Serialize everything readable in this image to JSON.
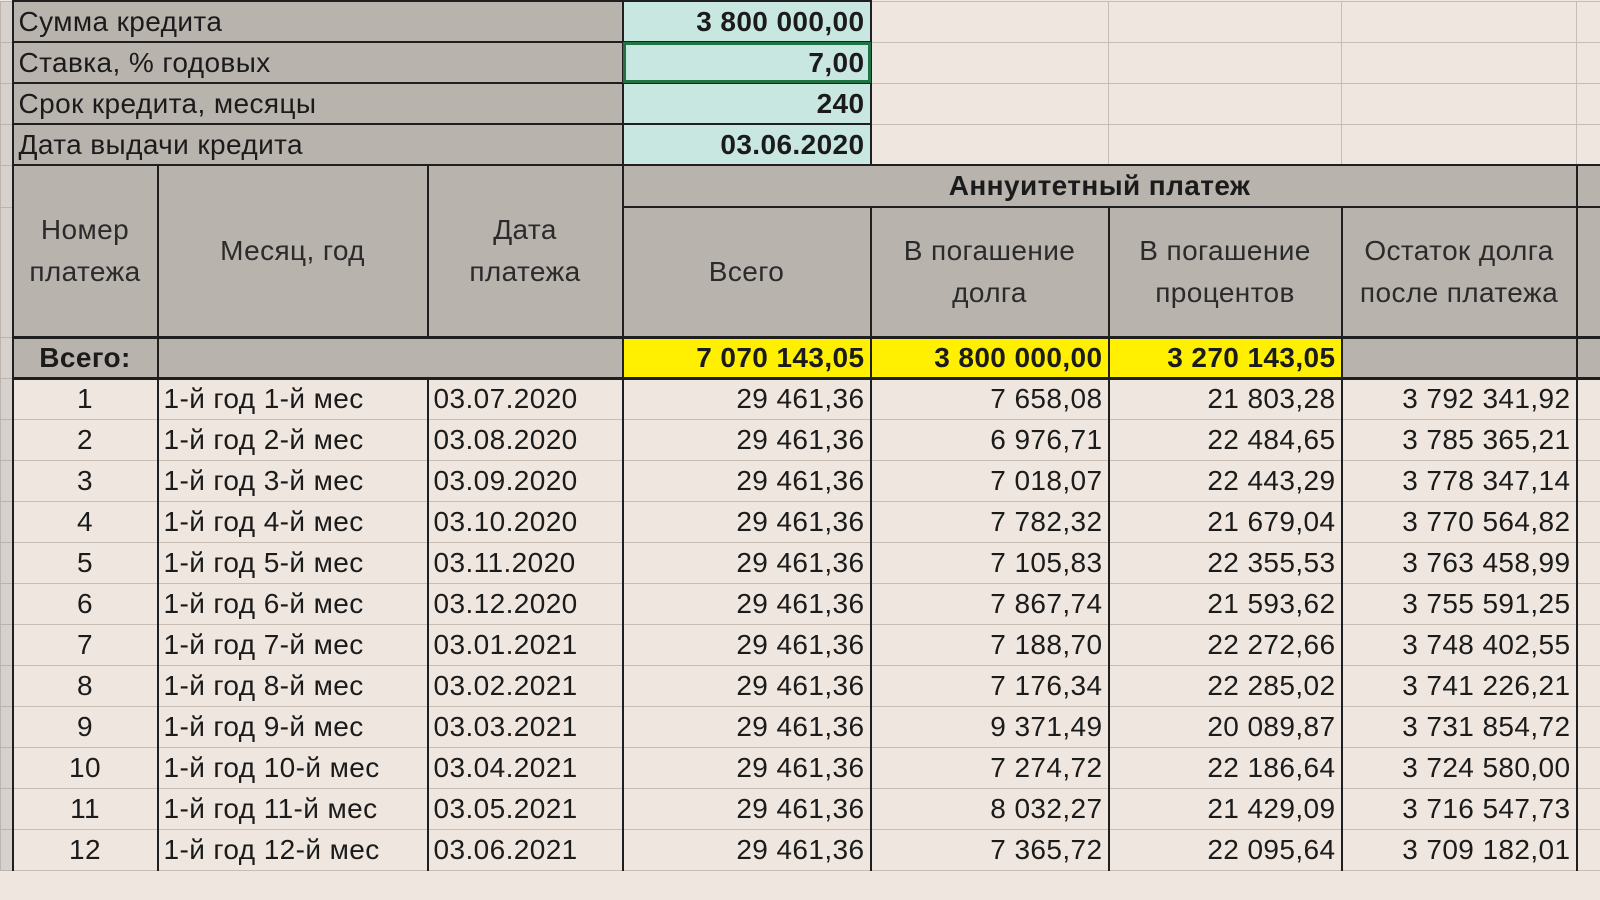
{
  "params": [
    {
      "label": "Сумма кредита",
      "value": "3 800 000,00"
    },
    {
      "label": "Ставка, % годовых",
      "value": "7,00"
    },
    {
      "label": "Срок кредита, месяцы",
      "value": "240"
    },
    {
      "label": "Дата выдачи кредита",
      "value": "03.06.2020"
    }
  ],
  "header": {
    "group": "Аннуитетный платеж",
    "num": "Номер платежа",
    "month": "Месяц, год",
    "date": "Дата платежа",
    "total": "Всего",
    "principal": "В погашение долга",
    "interest": "В погашение процентов",
    "balance": "Остаток долга после платежа"
  },
  "totals": {
    "label": "Всего:",
    "total": "7 070 143,05",
    "principal": "3 800 000,00",
    "interest": "3 270 143,05"
  },
  "rows": [
    {
      "n": "1",
      "m": "1-й год 1-й мес",
      "d": "03.07.2020",
      "t": "29 461,36",
      "p": "7 658,08",
      "i": "21 803,28",
      "b": "3 792 341,92"
    },
    {
      "n": "2",
      "m": "1-й год 2-й мес",
      "d": "03.08.2020",
      "t": "29 461,36",
      "p": "6 976,71",
      "i": "22 484,65",
      "b": "3 785 365,21"
    },
    {
      "n": "3",
      "m": "1-й год 3-й мес",
      "d": "03.09.2020",
      "t": "29 461,36",
      "p": "7 018,07",
      "i": "22 443,29",
      "b": "3 778 347,14"
    },
    {
      "n": "4",
      "m": "1-й год 4-й мес",
      "d": "03.10.2020",
      "t": "29 461,36",
      "p": "7 782,32",
      "i": "21 679,04",
      "b": "3 770 564,82"
    },
    {
      "n": "5",
      "m": "1-й год 5-й мес",
      "d": "03.11.2020",
      "t": "29 461,36",
      "p": "7 105,83",
      "i": "22 355,53",
      "b": "3 763 458,99"
    },
    {
      "n": "6",
      "m": "1-й год 6-й мес",
      "d": "03.12.2020",
      "t": "29 461,36",
      "p": "7 867,74",
      "i": "21 593,62",
      "b": "3 755 591,25"
    },
    {
      "n": "7",
      "m": "1-й год 7-й мес",
      "d": "03.01.2021",
      "t": "29 461,36",
      "p": "7 188,70",
      "i": "22 272,66",
      "b": "3 748 402,55"
    },
    {
      "n": "8",
      "m": "1-й год 8-й мес",
      "d": "03.02.2021",
      "t": "29 461,36",
      "p": "7 176,34",
      "i": "22 285,02",
      "b": "3 741 226,21"
    },
    {
      "n": "9",
      "m": "1-й год 9-й мес",
      "d": "03.03.2021",
      "t": "29 461,36",
      "p": "9 371,49",
      "i": "20 089,87",
      "b": "3 731 854,72"
    },
    {
      "n": "10",
      "m": "1-й год 10-й мес",
      "d": "03.04.2021",
      "t": "29 461,36",
      "p": "7 274,72",
      "i": "22 186,64",
      "b": "3 724 580,00"
    },
    {
      "n": "11",
      "m": "1-й год 11-й мес",
      "d": "03.05.2021",
      "t": "29 461,36",
      "p": "8 032,27",
      "i": "21 429,09",
      "b": "3 716 547,73"
    },
    {
      "n": "12",
      "m": "1-й год 12-й мес",
      "d": "03.06.2021",
      "t": "29 461,36",
      "p": "7 365,72",
      "i": "22 095,64",
      "b": "3 709 182,01"
    }
  ],
  "colors": {
    "input_cell": "#c9e7e1",
    "header_cell": "#b9b3ae",
    "totals_highlight": "#ffef00",
    "selection": "#217346"
  }
}
